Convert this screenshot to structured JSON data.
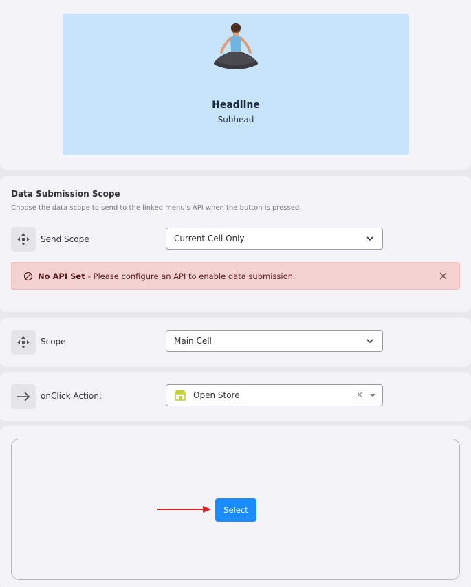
{
  "hero": {
    "headline": "Headline",
    "subhead": "Subhead"
  },
  "data_scope": {
    "title": "Data Submission Scope",
    "description": "Choose the data scope to send to the linked menu's API when the button is pressed.",
    "send_scope_label": "Send Scope",
    "send_scope_value": "Current Cell Only",
    "alert_title": "No API Set",
    "alert_message": "- Please configure an API to enable data submission."
  },
  "scope": {
    "label": "Scope",
    "value": "Main Cell"
  },
  "onclick": {
    "label": "onClick Action:",
    "value": "Open Store",
    "clear_glyph": "×"
  },
  "preview": {
    "button_label": "Select"
  },
  "colors": {
    "accent": "#1a8cff",
    "hero_bg": "#c8e4fb",
    "alert_bg": "#f5d2d2",
    "arrow": "#e02020",
    "store_icon": "#c5d33a"
  },
  "icons": {
    "scope": "move-arrows-icon",
    "onclick": "arrow-right-icon",
    "alert": "ban-icon",
    "store": "store-icon"
  }
}
